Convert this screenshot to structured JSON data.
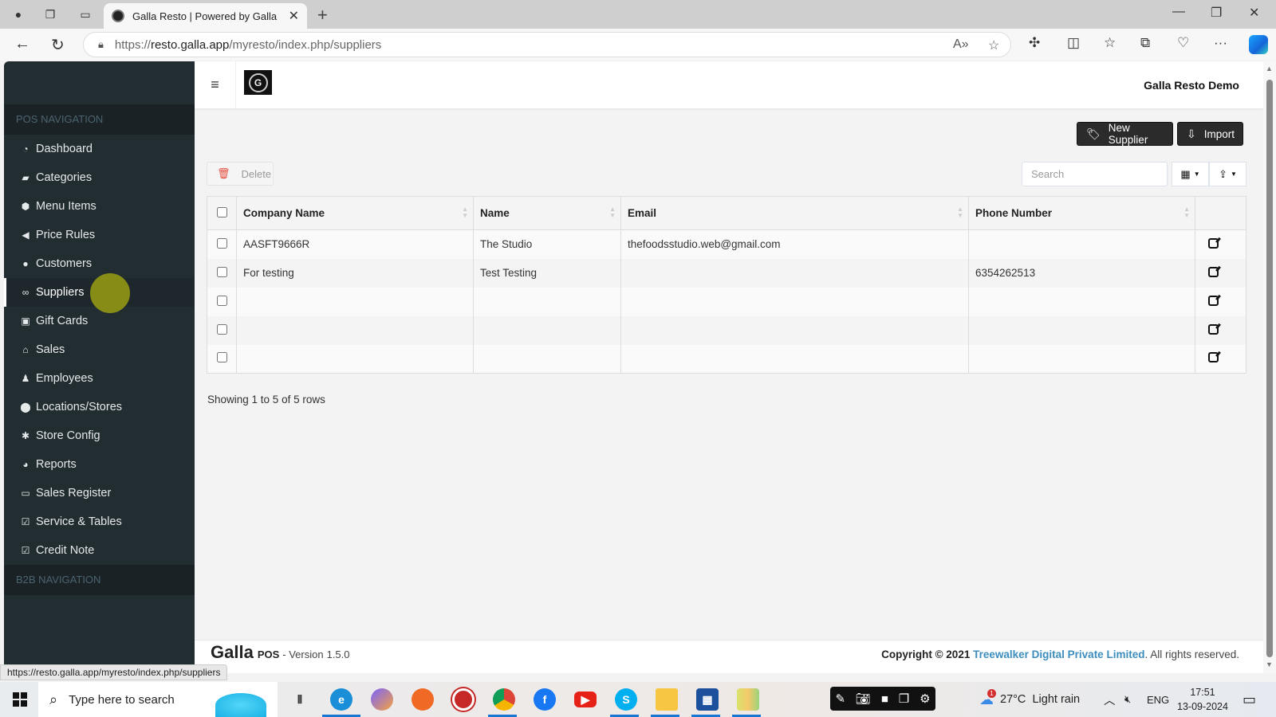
{
  "browser": {
    "tab_title": "Galla Resto | Powered by Galla",
    "url_prefix": "https://",
    "url_host": "resto.galla.app",
    "url_path": "/myresto/index.php/suppliers",
    "status_url": "https://resto.galla.app/myresto/index.php/suppliers"
  },
  "header": {
    "brand_name": "Galla Resto Demo",
    "logo_glyph": "G"
  },
  "sidebar": {
    "section_pos": "POS NAVIGATION",
    "section_b2b": "B2B NAVIGATION",
    "items": [
      {
        "label": "Dashboard",
        "icon": "dashboard-icon",
        "glyph": "◔"
      },
      {
        "label": "Categories",
        "icon": "folder-open-icon",
        "glyph": "▰"
      },
      {
        "label": "Menu Items",
        "icon": "cube-icon",
        "glyph": "⬢"
      },
      {
        "label": "Price Rules",
        "icon": "bullhorn-icon",
        "glyph": "◀"
      },
      {
        "label": "Customers",
        "icon": "user-circle-icon",
        "glyph": "●"
      },
      {
        "label": "Suppliers",
        "icon": "handshake-icon",
        "glyph": "∞"
      },
      {
        "label": "Gift Cards",
        "icon": "gift-icon",
        "glyph": "▣"
      },
      {
        "label": "Sales",
        "icon": "basket-icon",
        "glyph": "⌂"
      },
      {
        "label": "Employees",
        "icon": "users-icon",
        "glyph": "♟"
      },
      {
        "label": "Locations/Stores",
        "icon": "map-marker-icon",
        "glyph": "⬤"
      },
      {
        "label": "Store Config",
        "icon": "gear-icon",
        "glyph": "✱"
      },
      {
        "label": "Reports",
        "icon": "pie-chart-icon",
        "glyph": "◕"
      },
      {
        "label": "Sales Register",
        "icon": "money-icon",
        "glyph": "▭"
      },
      {
        "label": "Service & Tables",
        "icon": "check-square-icon",
        "glyph": "☑"
      },
      {
        "label": "Credit Note",
        "icon": "check-square-icon",
        "glyph": "☑"
      }
    ],
    "active_index": 5
  },
  "toolbar": {
    "new_supplier_label": "New Supplier",
    "import_label": "Import",
    "delete_label": "Delete",
    "search_placeholder": "Search"
  },
  "table": {
    "columns": [
      "Company Name",
      "Name",
      "Email",
      "Phone Number"
    ],
    "rows": [
      {
        "company": "AASFT9666R",
        "name": "The Studio",
        "email": "thefoodsstudio.web@gmail.com",
        "phone": ""
      },
      {
        "company": "For testing",
        "name": "Test Testing",
        "email": "",
        "phone": "6354262513"
      },
      {
        "company": "",
        "name": "",
        "email": "",
        "phone": ""
      },
      {
        "company": "",
        "name": "",
        "email": "",
        "phone": ""
      },
      {
        "company": "",
        "name": "",
        "email": "",
        "phone": ""
      }
    ],
    "pagination_text": "Showing 1 to 5 of 5 rows"
  },
  "footer": {
    "brand": "Galla",
    "pos": "POS",
    "version_label": "- Version",
    "version": "1.5.0",
    "copyright": "Copyright © 2021",
    "company_link": "Treewalker Digital Private Limited",
    "rights": ". All rights reserved."
  },
  "taskbar": {
    "search_placeholder": "Type here to search",
    "weather_temp": "27°C",
    "weather_desc": "Light rain",
    "weather_badge": "1",
    "language": "ENG",
    "time": "17:51",
    "date": "13-09-2024"
  },
  "colors": {
    "sidebar_bg": "#222d32",
    "link_blue": "#3c8dbc",
    "dark_button": "#2b2b2b",
    "delete_red": "#e74c3c"
  }
}
